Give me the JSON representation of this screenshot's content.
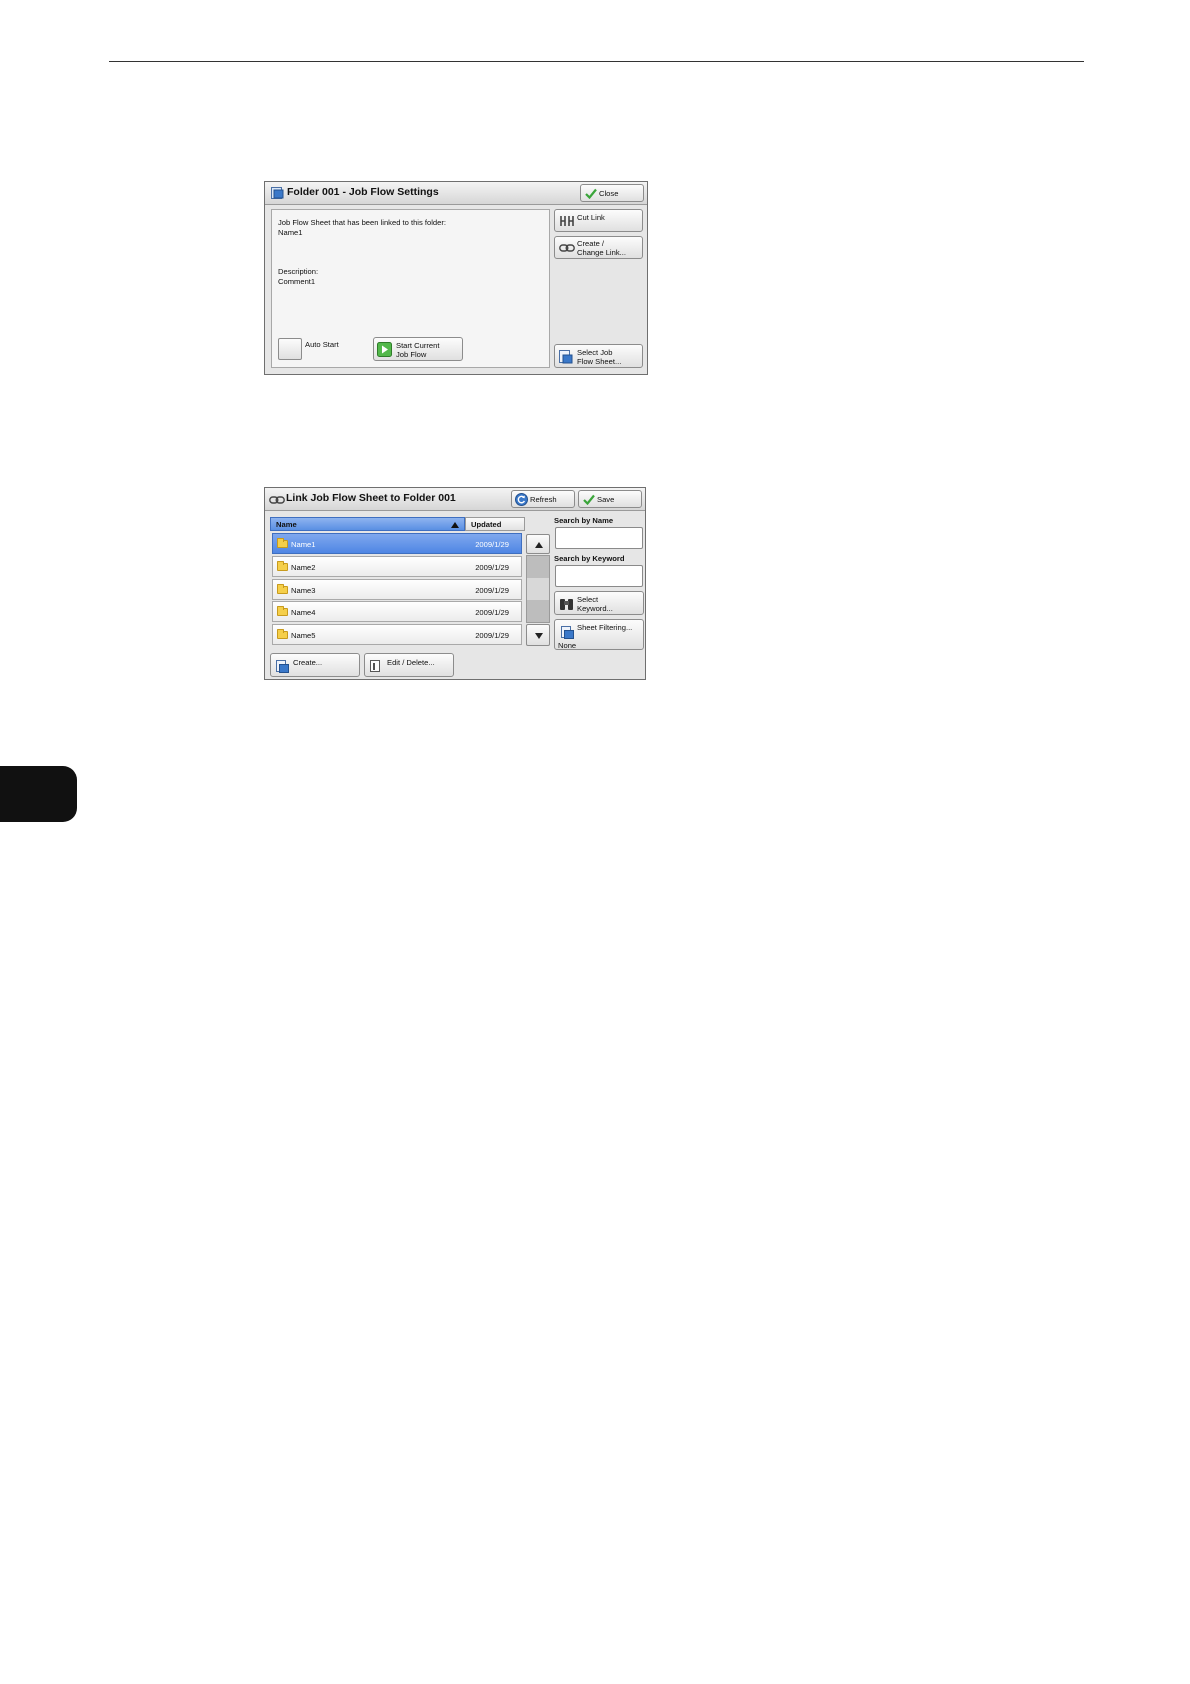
{
  "screen1": {
    "title": "Folder 001 - Job Flow Settings",
    "close_label": "Close",
    "linked_sheet_label": "Job Flow Sheet that has been linked to this folder:",
    "linked_sheet_name": "Name1",
    "description_label": "Description:",
    "description_value": "Comment1",
    "auto_start_label": "Auto Start",
    "start_current_label": "Start Current\nJob Flow",
    "cut_link_label": "Cut Link",
    "create_change_link_label": "Create /\nChange Link...",
    "select_job_flow_sheet_label": "Select Job\nFlow Sheet..."
  },
  "screen2": {
    "title": "Link Job Flow Sheet to Folder 001",
    "refresh_label": "Refresh",
    "save_label": "Save",
    "columns": {
      "name": "Name",
      "updated": "Updated"
    },
    "rows": [
      {
        "name": "Name1",
        "updated": "2009/1/29",
        "selected": true
      },
      {
        "name": "Name2",
        "updated": "2009/1/29",
        "selected": false
      },
      {
        "name": "Name3",
        "updated": "2009/1/29",
        "selected": false
      },
      {
        "name": "Name4",
        "updated": "2009/1/29",
        "selected": false
      },
      {
        "name": "Name5",
        "updated": "2009/1/29",
        "selected": false
      }
    ],
    "search_by_name_label": "Search by Name",
    "search_by_keyword_label": "Search by Keyword",
    "select_keyword_label": "Select\nKeyword...",
    "sheet_filtering_label": "Sheet Filtering...",
    "sheet_filtering_value": "None",
    "create_label": "Create...",
    "edit_delete_label": "Edit / Delete..."
  },
  "colors": {
    "selection_blue": "#4f86e4",
    "panel_gray": "#e6e6e6",
    "check_green": "#3aa53a"
  }
}
